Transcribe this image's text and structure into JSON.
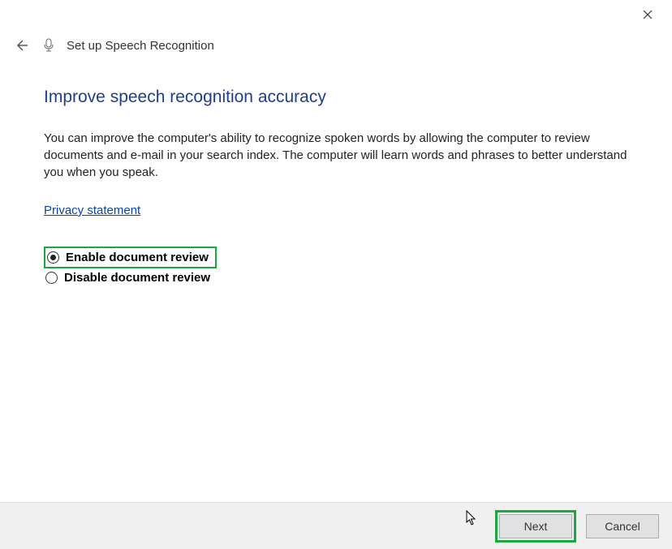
{
  "window": {
    "title": "Set up Speech Recognition"
  },
  "page": {
    "heading": "Improve speech recognition accuracy",
    "description": "You can improve the computer's ability to recognize spoken words by allowing the computer to review documents and e-mail in your search index. The computer will learn words and phrases to better understand you when you speak.",
    "privacy_link": "Privacy statement"
  },
  "options": {
    "enable": "Enable document review",
    "disable": "Disable document review",
    "selected": "enable"
  },
  "buttons": {
    "next": "Next",
    "cancel": "Cancel"
  }
}
